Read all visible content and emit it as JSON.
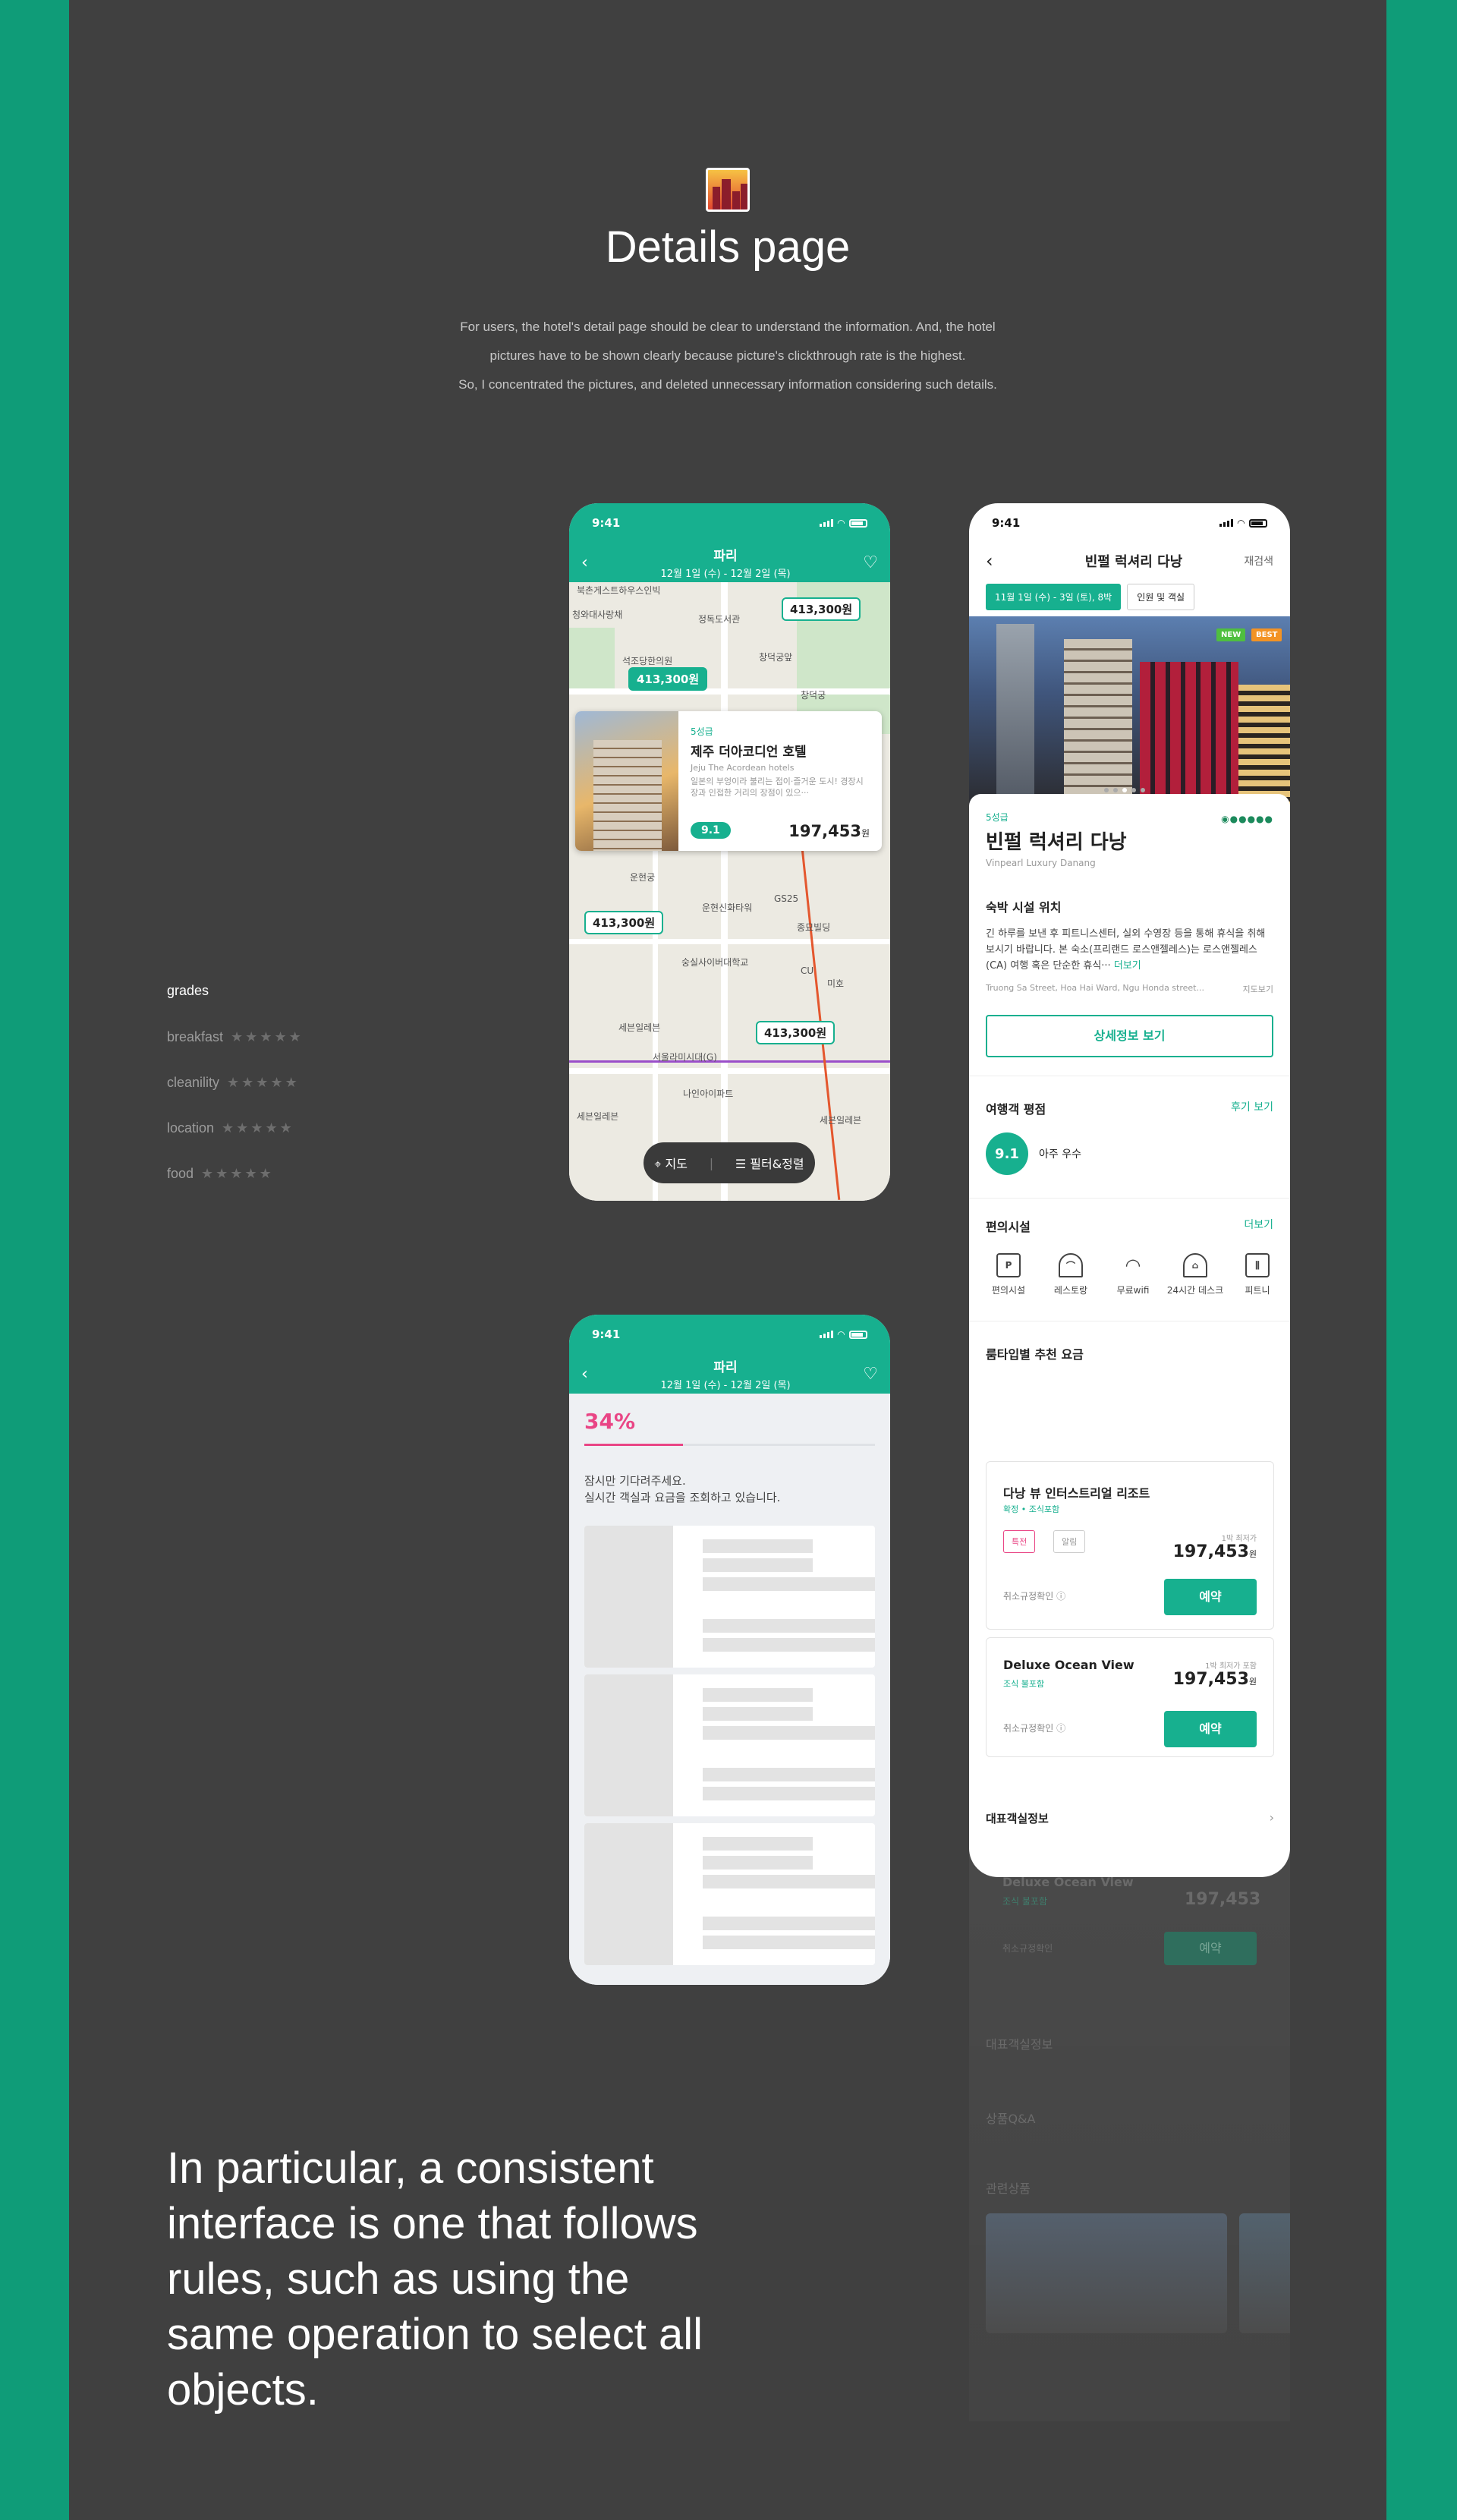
{
  "colors": {
    "background": "#404040",
    "frame": "#0f9c78",
    "accent": "#17b08f",
    "percent": "#e94585"
  },
  "heading": "Details page",
  "intro": [
    "For users, the hotel's detail page should be clear to understand the information. And, the hotel",
    "pictures have to be shown clearly because picture's clickthrough rate is the highest.",
    "So, I concentrated the pictures, and deleted unnecessary information considering such details."
  ],
  "grades": {
    "title": "grades",
    "rows": [
      {
        "label": "breakfast",
        "stars": 5
      },
      {
        "label": "cleanility",
        "stars": 5
      },
      {
        "label": "location",
        "stars": 5
      },
      {
        "label": "food",
        "stars": 5
      }
    ]
  },
  "quote": "In particular, a consistent interface is one that follows rules, such as using the same operation to select all objects.",
  "status_time": "9:41",
  "map_phone": {
    "title": "파리",
    "dates": "12월 1일 (수) - 12월 2일 (목)",
    "pins": [
      "413,300원",
      "413,300원",
      "413,300원",
      "413,300원"
    ],
    "labels": [
      "북촌게스트하우스인빅",
      "정독도서관",
      "청와대사랑채",
      "석조당한의원",
      "창덕궁앞",
      "창덕궁",
      "운현궁",
      "운현신화타워",
      "GS25",
      "종묘빌딩",
      "숭실사이버대학교",
      "세븐일레븐",
      "서울라미시대(G)",
      "나인아이파트",
      "CU",
      "미호",
      "세븐일레븐",
      "세븐일레븐"
    ],
    "card": {
      "grade": "5성급",
      "name": "제주 더아코디언 호텔",
      "en": "Jeju The Acordean hotels",
      "desc": "일본의 부엉이라 불리는 접이·즐거운 도시! 경장시장과 인접한 거리의 장점이 있으···",
      "score": "9.1",
      "price": "197,453",
      "unit": "원"
    },
    "pill": {
      "map": "지도",
      "filter": "필터&정렬"
    }
  },
  "loading_phone": {
    "title": "파리",
    "dates": "12월 1일 (수) - 12월 2일 (목)",
    "percent": "34%",
    "percent_value": 34,
    "msg1": "잠시만 기다려주세요.",
    "msg2": "실시간 객실과 요금을 조회하고 있습니다."
  },
  "detail_phone": {
    "title": "빈펄 럭셔리 다낭",
    "search": "재검색",
    "chip_date": "11월 1일 (수) - 3일 (토), 8박",
    "chip_guests": "인원 및 객실",
    "badge_new": "NEW",
    "badge_best": "BEST",
    "grade": "5성급",
    "name": "빈펄 럭셔리 다낭",
    "en": "Vinpearl Luxury Danang",
    "loc_title": "숙박 시설 위치",
    "loc_desc": "긴 하루를 보낸 후 피트니스센터, 실외 수영장 등을 통해 휴식을 취해보시기 바랍니다. 본 숙소(프리랜드 로스앤젤레스)는 로스앤젤레스 (CA) 여행 혹은 단순한 휴식···",
    "more": "더보기",
    "address": "Truong Sa Street, Hoa Hai Ward, Ngu Honda street...",
    "map_link": "지도보기",
    "detail_btn": "상세정보 보기",
    "review_title": "여행객 평점",
    "review_link": "후기 보기",
    "score": "9.1",
    "score_text": "아주 우수",
    "amen_title": "편의시설",
    "amen_more": "더보기",
    "amenities": [
      {
        "icon": "parking-icon",
        "label": "편의시설"
      },
      {
        "icon": "restaurant-icon",
        "label": "레스토랑"
      },
      {
        "icon": "wifi-icon",
        "label": "무료wifi"
      },
      {
        "icon": "front-desk-icon",
        "label": "24시간 데스크"
      },
      {
        "icon": "fitness-icon",
        "label": "피트니"
      }
    ],
    "rate_title": "룸타입별 추천 요금",
    "rooms": [
      {
        "name": "다낭 뷰 인터스트리얼 리조트",
        "sub": "확정 • 조식포함",
        "tag1": "특전",
        "tag2": "알림",
        "per": "1박 최저가",
        "price": "197,453",
        "unit": "원",
        "cancel": "취소규정확인",
        "book": "예약"
      },
      {
        "name": "Deluxe Ocean View",
        "sub": "조식 불포함",
        "per": "1박 최저가 포함",
        "price": "197,453",
        "unit": "원",
        "cancel": "취소규정확인",
        "book": "예약"
      }
    ],
    "rep_room": "대표객실정보",
    "faded": {
      "room": "Deluxe Ocean View",
      "room_sub": "조식 불포함",
      "price": "197,453",
      "cancel": "취소규정확인",
      "book": "예약",
      "rep": "대표객실정보",
      "qa": "상품Q&A",
      "related": "관련상품"
    }
  }
}
